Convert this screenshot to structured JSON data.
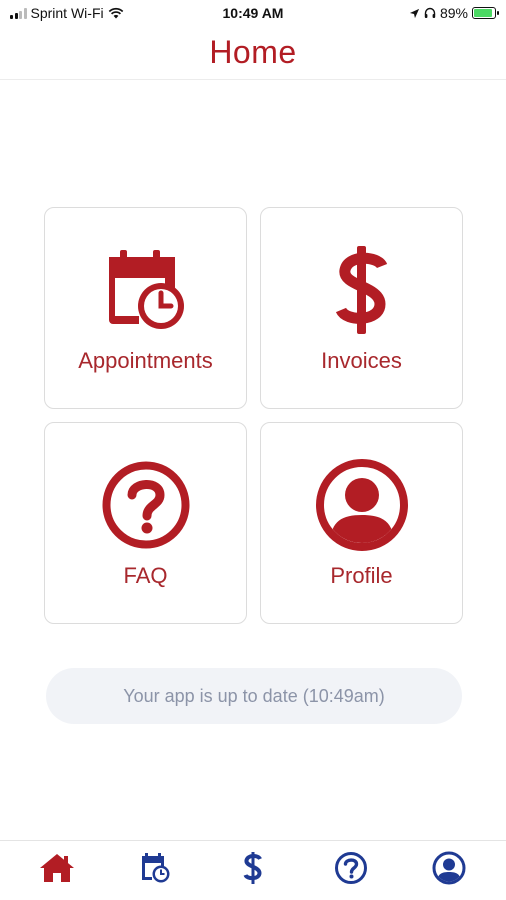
{
  "status_bar": {
    "carrier": "Sprint Wi-Fi",
    "time": "10:49 AM",
    "battery_percent": "89%",
    "battery_level": 0.89,
    "icons": [
      "signal-icon",
      "wifi-icon",
      "location-arrow-icon",
      "headphones-icon",
      "battery-charging-icon"
    ]
  },
  "header": {
    "title": "Home"
  },
  "tiles": [
    {
      "label": "Appointments",
      "icon": "calendar-clock-icon"
    },
    {
      "label": "Invoices",
      "icon": "dollar-sign-icon"
    },
    {
      "label": "FAQ",
      "icon": "question-circle-icon"
    },
    {
      "label": "Profile",
      "icon": "user-circle-icon"
    }
  ],
  "update_status": {
    "text": "Your app is up to date (10:49am)"
  },
  "tab_bar": {
    "tabs": [
      {
        "icon": "home-icon",
        "active": true
      },
      {
        "icon": "calendar-clock-icon",
        "active": false
      },
      {
        "icon": "dollar-sign-icon",
        "active": false
      },
      {
        "icon": "question-circle-icon",
        "active": false
      },
      {
        "icon": "user-circle-icon",
        "active": false
      }
    ]
  },
  "colors": {
    "brand_red": "#b21d24",
    "tab_active": "#b21d24",
    "tab_inactive": "#1f3a93",
    "pill_background": "#f1f3f7",
    "pill_text": "#8c94a8"
  }
}
